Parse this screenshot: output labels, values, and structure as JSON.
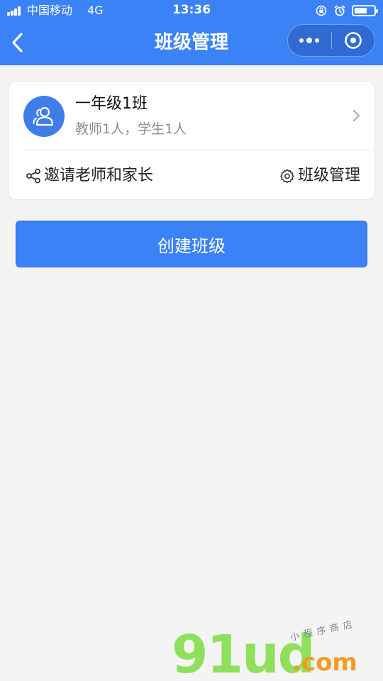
{
  "status_bar": {
    "carrier": "中国移动",
    "network": "4G",
    "time": "13:36",
    "battery_level": 0.65
  },
  "nav": {
    "title": "班级管理",
    "back_icon": "chevron-left-icon",
    "more_icon": "more-dots-icon",
    "close_icon": "target-circle-icon"
  },
  "class_card": {
    "name": "一年级1班",
    "meta": "教师1人，学生1人",
    "avatar_icon": "users-icon",
    "invite_label": "邀请老师和家长",
    "invite_icon": "share-icon",
    "manage_label": "班级管理",
    "manage_icon": "gear-icon"
  },
  "actions": {
    "create_label": "创建班级"
  },
  "watermark": {
    "brand": "91ud",
    "domain": ".com",
    "tagline": "小程序商店"
  },
  "colors": {
    "primary": "#3b82f6",
    "background": "#f4f4f4",
    "watermark_green": "#8fe05a",
    "watermark_orange": "#f59b24"
  }
}
